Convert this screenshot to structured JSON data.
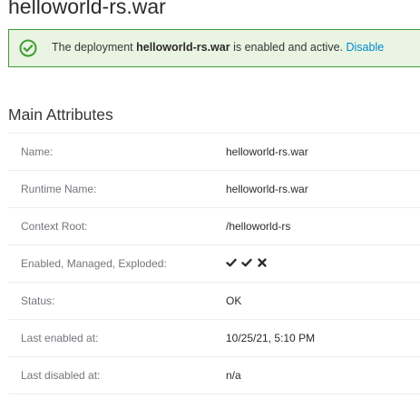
{
  "page": {
    "title": "helloworld-rs.war"
  },
  "alert": {
    "icon": "check-circle-icon",
    "prefix": "The deployment ",
    "name": "helloworld-rs.war",
    "suffix": " is enabled and active.",
    "action_label": "Disable",
    "colors": {
      "border": "#3f9c35",
      "background": "#e9f4e2",
      "link": "#0088ce"
    }
  },
  "main_attributes": {
    "heading": "Main Attributes",
    "rows": [
      {
        "label": "Name:",
        "value": "helloworld-rs.war"
      },
      {
        "label": "Runtime Name:",
        "value": "helloworld-rs.war"
      },
      {
        "label": "Context Root:",
        "value": "/helloworld-rs"
      },
      {
        "label": "Enabled, Managed, Exploded:",
        "flags": [
          {
            "name": "enabled",
            "state": true,
            "icon": "check-icon"
          },
          {
            "name": "managed",
            "state": true,
            "icon": "check-icon"
          },
          {
            "name": "exploded",
            "state": false,
            "icon": "times-icon"
          }
        ]
      },
      {
        "label": "Status:",
        "value": "OK"
      },
      {
        "label": "Last enabled at:",
        "value": "10/25/21, 5:10 PM"
      },
      {
        "label": "Last disabled at:",
        "value": "n/a"
      }
    ]
  }
}
